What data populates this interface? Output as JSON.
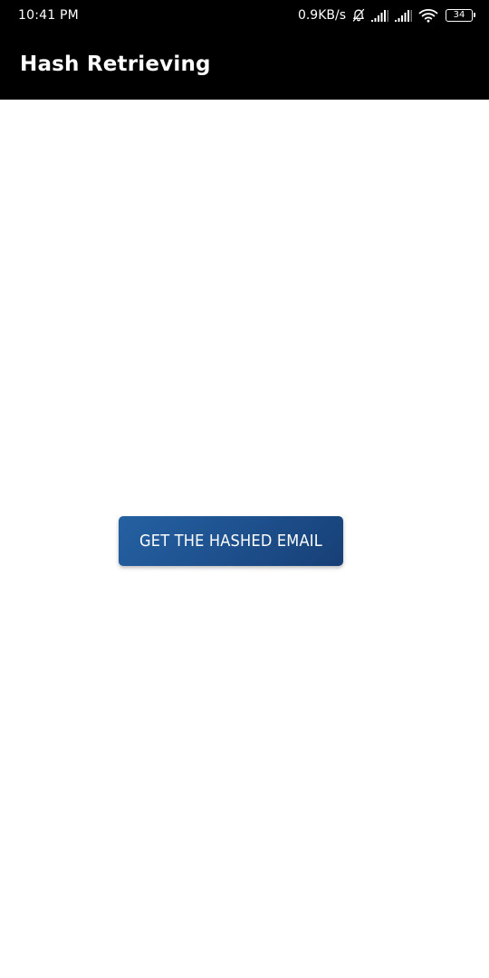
{
  "status_bar": {
    "time": "10:41 PM",
    "network_speed": "0.9KB/s",
    "battery_level": "34",
    "icons": [
      "notifications-off-icon",
      "signal-icon",
      "signal-icon",
      "wifi-icon",
      "battery-icon"
    ]
  },
  "app_bar": {
    "title": "Hash Retrieving"
  },
  "main": {
    "button_label": "GET THE HASHED EMAIL"
  },
  "colors": {
    "app_bar_background": "#000000",
    "button_background": "#1d4f8c",
    "button_text": "#ffffff",
    "page_background": "#ffffff"
  }
}
